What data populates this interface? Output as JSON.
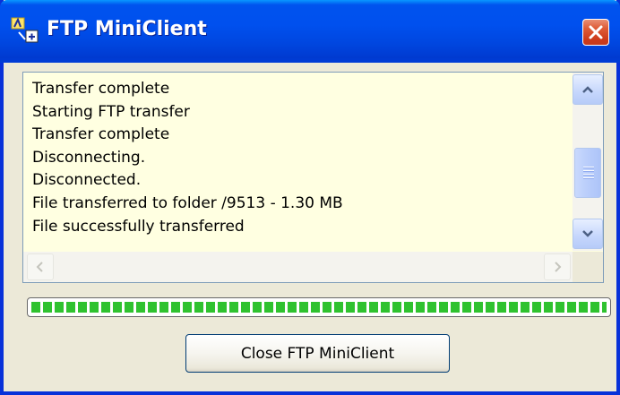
{
  "window": {
    "title": "FTP MiniClient",
    "title_bar_color": "#0053ee",
    "app_icon": "ftp-client-icon",
    "close_icon": "close-x-icon"
  },
  "log": {
    "background": "#ffffe1",
    "lines": [
      "Transfer complete",
      "Starting FTP transfer",
      "Transfer complete",
      "Disconnecting.",
      "Disconnected.",
      "File transferred to folder /9513 - 1.30 MB",
      "File successfully transferred"
    ]
  },
  "scrollbars": {
    "up_icon": "chevron-up-icon",
    "down_icon": "chevron-down-icon",
    "left_icon": "chevron-left-icon",
    "right_icon": "chevron-right-icon"
  },
  "progress": {
    "value_percent": 100,
    "color": "#2fc22f"
  },
  "buttons": {
    "close_client_label": "Close FTP MiniClient"
  }
}
